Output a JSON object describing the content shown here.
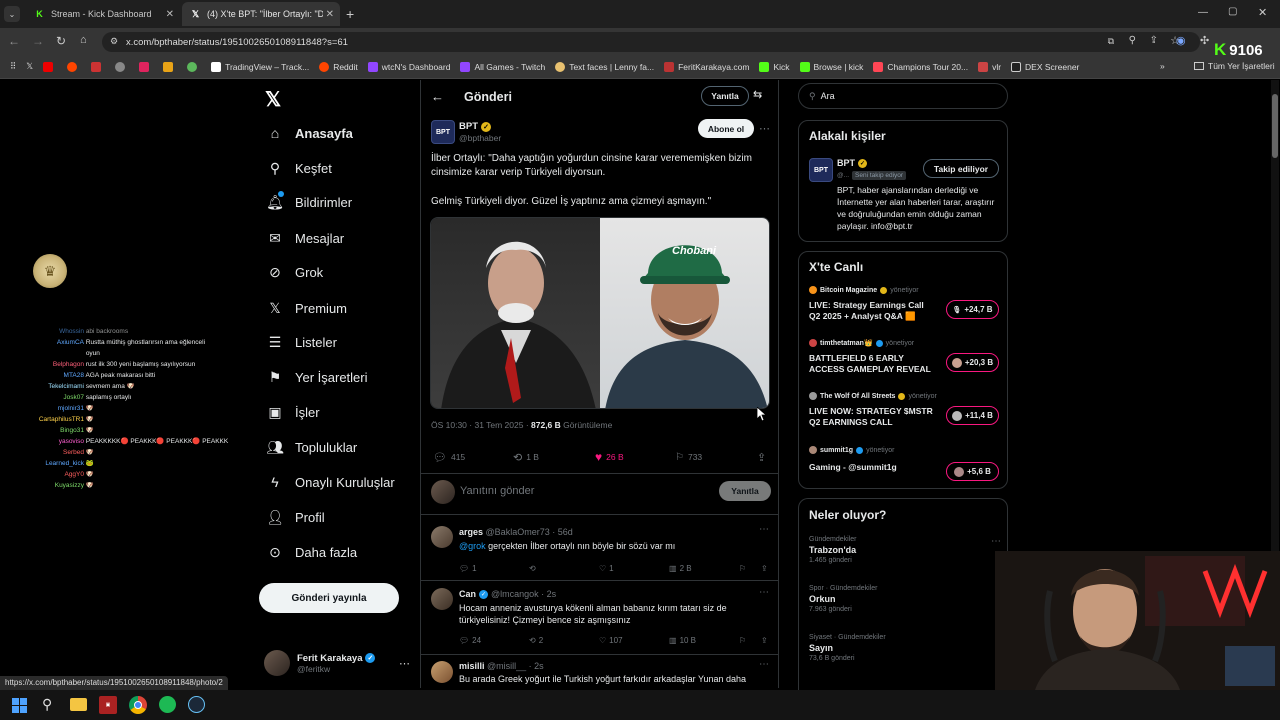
{
  "browser": {
    "tabs": [
      {
        "label": "Stream - Kick Dashboard",
        "active": false
      },
      {
        "label": "(4) X'te BPT: \"İlber Ortaylı: \"Daha",
        "active": true
      }
    ],
    "url": "x.com/bpthaber/status/1951002650108911848?s=61",
    "kick_count": "9106",
    "bookmarks": [
      "TradingView – Track...",
      "Reddit",
      "wtcN's Dashboard",
      "All Games - Twitch",
      "Text faces | Lenny fa...",
      "FeritKarakaya.com",
      "Kick",
      "Browse | kick",
      "Champions Tour 20...",
      "vlr",
      "DEX Screener"
    ],
    "all_bookmarks": "Tüm Yer İşaretleri",
    "status_url": "https://x.com/bpthaber/status/1951002650108911848/photo/2"
  },
  "nav": {
    "items": [
      {
        "label": "Anasayfa",
        "icon": "home-icon"
      },
      {
        "label": "Keşfet",
        "icon": "search-icon"
      },
      {
        "label": "Bildirimler",
        "icon": "bell-icon"
      },
      {
        "label": "Mesajlar",
        "icon": "mail-icon"
      },
      {
        "label": "Grok",
        "icon": "grok-icon"
      },
      {
        "label": "Premium",
        "icon": "x-logo-icon"
      },
      {
        "label": "Listeler",
        "icon": "list-icon"
      },
      {
        "label": "Yer İşaretleri",
        "icon": "bookmark-icon"
      },
      {
        "label": "İşler",
        "icon": "briefcase-icon"
      },
      {
        "label": "Topluluklar",
        "icon": "people-icon"
      },
      {
        "label": "Onaylı Kuruluşlar",
        "icon": "lightning-icon"
      },
      {
        "label": "Profil",
        "icon": "person-icon"
      },
      {
        "label": "Daha fazla",
        "icon": "more-circle-icon"
      }
    ],
    "post_button": "Gönderi yayınla",
    "account": {
      "name": "Ferit Karakaya",
      "handle": "@feritkw"
    }
  },
  "post": {
    "header_title": "Gönderi",
    "reply_button": "Yanıtla",
    "author": {
      "name": "BPT",
      "handle": "@bpthaber"
    },
    "subscribe_button": "Abone ol",
    "text1": "İlber Ortaylı: \"Daha yaptığın yoğurdun cinsine karar verememişken bizim cinsimize karar verip Türkiyeli diyorsun.",
    "text2": "Gelmiş Türkiyeli diyor. Güzel İş yaptınız ama çizmeyi aşmayın.\"",
    "time": "ÖS 10:30 · 31 Tem 2025 · ",
    "views_count": "872,6 B",
    "views_label": " Görüntüleme",
    "replies": "415",
    "reposts": "1 B",
    "likes": "26 B",
    "bookmarks": "733",
    "reply_placeholder": "Yanıtını gönder",
    "reply_submit": "Yanıtla"
  },
  "replies": [
    {
      "name": "arges",
      "handle": "@BaklaOmer73 · 56d",
      "mention": "@grok",
      "text": " gerçekten İlber ortaylı nın böyle bir sözü var mı",
      "replies": "1",
      "reposts": "",
      "likes": "1",
      "views": "2 B"
    },
    {
      "name": "Can",
      "handle": "@lmcangok · 2s",
      "mention": "",
      "text": "Hocam anneniz avusturya kökenli alman babanız kırım tatarı siz de türkiyelisiniz! Çizmeyi bence siz aşmışsınız",
      "replies": "24",
      "reposts": "2",
      "likes": "107",
      "views": "10 B"
    },
    {
      "name": "misilli",
      "handle": "@misill__ · 2s",
      "mention": "",
      "text": "Bu arada Greek yoğurt ile Turkish yoğurt farkıdır arkadaşlar Yunan daha",
      "replies": "",
      "reposts": "",
      "likes": "",
      "views": ""
    }
  ],
  "search": {
    "placeholder": "Ara"
  },
  "related": {
    "title": "Alakalı kişiler",
    "name": "BPT",
    "handle": "@...",
    "follows_you": "Seni takip ediyor",
    "follow_button": "Takip ediliyor",
    "bio": "BPT, haber ajanslarından derlediği ve İnternette yer alan haberleri tarar, araştırır ve doğruluğundan emin olduğu zaman paylaşır. info@bpt.tr"
  },
  "live": {
    "title": "X'te Canlı",
    "items": [
      {
        "host": "Bitcoin Magazine",
        "status": "yönetiyor",
        "title": "LIVE: Strategy Earnings Call Q2 2025 + Analyst Q&A 🟧",
        "count": "+24,7 B"
      },
      {
        "host": "timthetatman👑",
        "status": "yönetiyor",
        "title": "BATTLEFIELD 6 EARLY ACCESS GAMEPLAY REVEAL",
        "count": "+20,3 B"
      },
      {
        "host": "The Wolf Of All Streets",
        "status": "yönetiyor",
        "title": "LIVE NOW: STRATEGY $MSTR Q2 EARNINGS CALL",
        "count": "+11,4 B"
      },
      {
        "host": "summit1g",
        "status": "yönetiyor",
        "title": "Gaming - @summit1g",
        "count": "+5,6 B"
      }
    ]
  },
  "trends": {
    "title": "Neler oluyor?",
    "items": [
      {
        "category": "Gündemdekiler",
        "name": "Trabzon'da",
        "count": "1.465 gönderi"
      },
      {
        "category": "Spor · Gündemdekiler",
        "name": "Orkun",
        "count": "7.963 gönderi"
      },
      {
        "category": "Siyaset · Gündemdekiler",
        "name": "Sayın",
        "count": "73,6 B gönderi"
      }
    ]
  },
  "chat": [
    {
      "user": "Whossin",
      "msg": "abi backrooms",
      "color": "#5fa8ff"
    },
    {
      "user": "AxiumCA",
      "msg": "Rustta müthiş ghostlarırsın ama eğlenceli",
      "color": "#5fa8ff"
    },
    {
      "user": "",
      "msg": "oyun",
      "color": "#5fa8ff"
    },
    {
      "user": "Belphagon",
      "msg": "rust ilk 300 yeni başlamış sayılıyorsun",
      "color": "#ff5f7a"
    },
    {
      "user": "MTA28",
      "msg": "AGA peak makarası bitti",
      "color": "#5fa8ff"
    },
    {
      "user": "Tekelcimami",
      "msg": "sevmem ama 🐶",
      "color": "#9fe0ff"
    },
    {
      "user": "Josk07",
      "msg": "saplamış ortaylı",
      "color": "#7fdc6b"
    },
    {
      "user": "mjolnir31",
      "msg": "🐶",
      "color": "#5fa8ff"
    },
    {
      "user": "CartaphilusTR1",
      "msg": "🐶",
      "color": "#ffd24a"
    },
    {
      "user": "Bingo31",
      "msg": "🐶",
      "color": "#7fdc6b"
    },
    {
      "user": "yasoviso",
      "msg": "PEAKKKKK🔴 PEAKKK🔴 PEAKKK🔴 PEAKKK",
      "color": "#ff5fd0"
    },
    {
      "user": "Serbed",
      "msg": "🐶",
      "color": "#ff5f5f"
    },
    {
      "user": "Learned_kick",
      "msg": "🐸",
      "color": "#5fa8ff"
    },
    {
      "user": "AggY0",
      "msg": "🐶",
      "color": "#ff5f5f"
    },
    {
      "user": "Kuyasizzy",
      "msg": "🐶",
      "color": "#7fdc6b"
    }
  ],
  "colors": {
    "accent": "#1d9bf0",
    "like": "#f91880",
    "kick": "#53fc18"
  }
}
